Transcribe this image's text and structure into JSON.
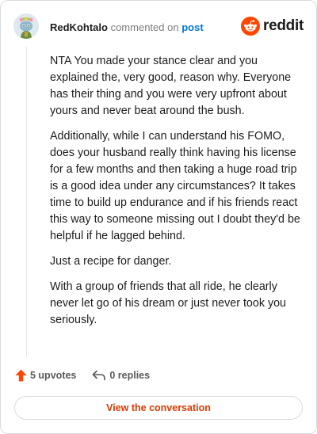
{
  "header": {
    "username": "RedKohtalo",
    "action_text": "commented on",
    "post_link": "post",
    "brand": "reddit"
  },
  "comment": {
    "paragraphs": [
      "NTA You made your stance clear and you explained the, very good, reason why. Everyone has their thing and you were very upfront about yours and never beat around the bush.",
      "Additionally, while I can understand his FOMO, does your husband really think having his license for a few months and then taking a huge road trip is a good idea under any circumstances? It takes time to build up endurance and if his friends react this way to someone missing out I doubt they'd be helpful if he lagged behind.",
      "Just a recipe for danger.",
      "With a group of friends that all ride, he clearly never let go of his dream or just never took you seriously."
    ]
  },
  "actions": {
    "upvotes": "5 upvotes",
    "replies": "0 replies"
  },
  "footer": {
    "view_button": "View the conversation"
  },
  "colors": {
    "brand": "#ff4500",
    "link": "#0079d3",
    "button_text": "#d93a00"
  },
  "icons": {
    "avatar": "snoo-avatar",
    "brand": "reddit-logo-icon",
    "upvote": "upvote-arrow-icon",
    "reply": "reply-arrow-icon"
  }
}
